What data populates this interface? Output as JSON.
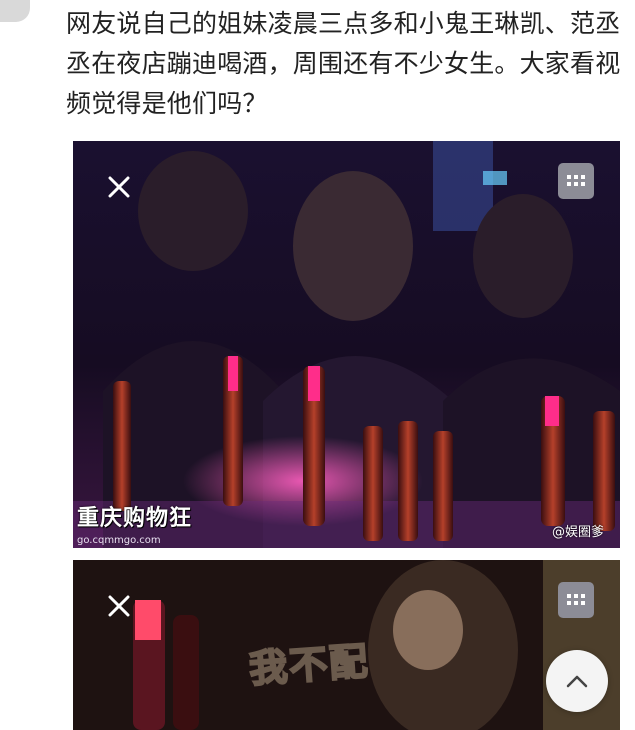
{
  "post": {
    "text": "网友说自己的姐妹凌晨三点多和小鬼王琳凯、范丞丞在夜店蹦迪喝酒，周围还有不少女生。大家看视频觉得是他们吗？"
  },
  "media_1": {
    "close_icon": "close-icon",
    "grid_icon": "grid-icon",
    "logo_text": "重庆购物狂",
    "logo_url": "go.cqmmgo.com",
    "watermark": "@娱圈爹"
  },
  "media_2": {
    "close_icon": "close-icon",
    "grid_icon": "grid-icon",
    "subtitle": "我不配"
  },
  "scroll_top": {
    "icon": "chevron-up-icon"
  },
  "colors": {
    "text": "#222222",
    "background": "#ffffff",
    "photo_dark": "#140a1c",
    "neon_pink": "#ff2d8a"
  }
}
